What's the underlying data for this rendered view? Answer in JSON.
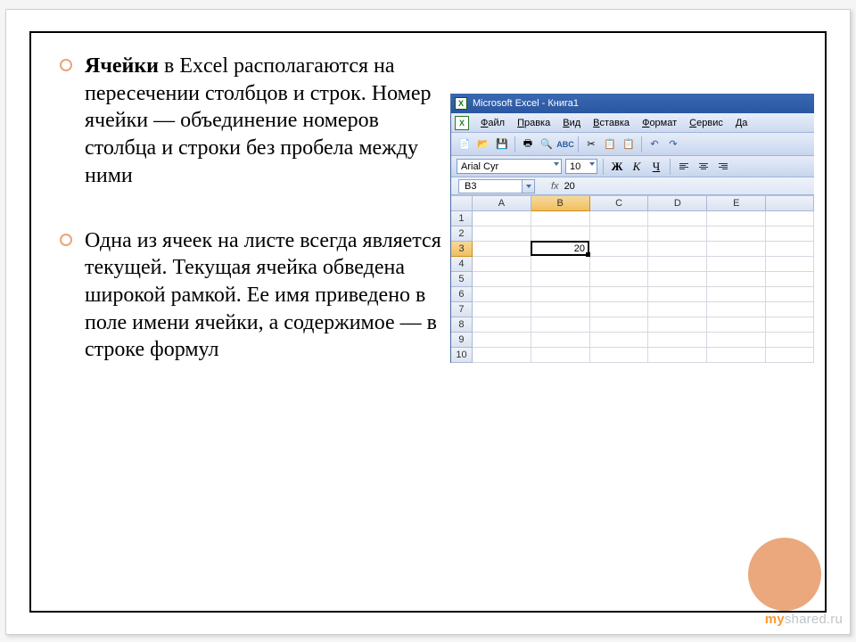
{
  "bullets": [
    {
      "bold": "Ячейки",
      "rest": " в Excel располагаются на пересечении столбцов и строк. Номер ячейки — объединение номеров столбца и строки без пробела между ними"
    },
    {
      "bold": "",
      "rest": "Одна из ячеек на листе всегда является текущей. Текущая ячейка обведена широкой рамкой. Ее имя приведено в поле имени ячейки, а содержимое — в строке формул"
    }
  ],
  "watermark": {
    "my": "my",
    "rest": "shared.ru"
  },
  "excel": {
    "title": "Microsoft Excel - Книга1",
    "menus": [
      "Файл",
      "Правка",
      "Вид",
      "Вставка",
      "Формат",
      "Сервис",
      "Да"
    ],
    "font_name": "Arial Cyr",
    "font_size": "10",
    "bold": "Ж",
    "italic": "К",
    "underline": "Ч",
    "namebox": "B3",
    "fx_label": "fx",
    "formula_value": "20",
    "columns": [
      "A",
      "B",
      "C",
      "D",
      "E"
    ],
    "rows": 10,
    "active_row": 3,
    "active_col": "B",
    "active_value": "20"
  }
}
